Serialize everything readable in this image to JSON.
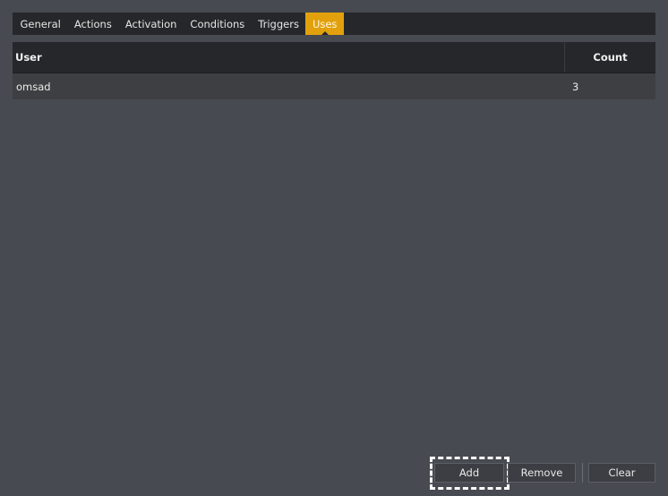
{
  "tabs": [
    {
      "label": "General"
    },
    {
      "label": "Actions"
    },
    {
      "label": "Activation"
    },
    {
      "label": "Conditions"
    },
    {
      "label": "Triggers"
    },
    {
      "label": "Uses",
      "active": true
    }
  ],
  "table": {
    "headers": {
      "user": "User",
      "count": "Count"
    },
    "rows": [
      {
        "user": "omsad",
        "count": "3"
      }
    ]
  },
  "buttons": {
    "add": "Add",
    "remove": "Remove",
    "clear": "Clear"
  },
  "colors": {
    "background": "#474a51",
    "tab_active": "#e2a10c",
    "header_bg": "#26272a"
  }
}
